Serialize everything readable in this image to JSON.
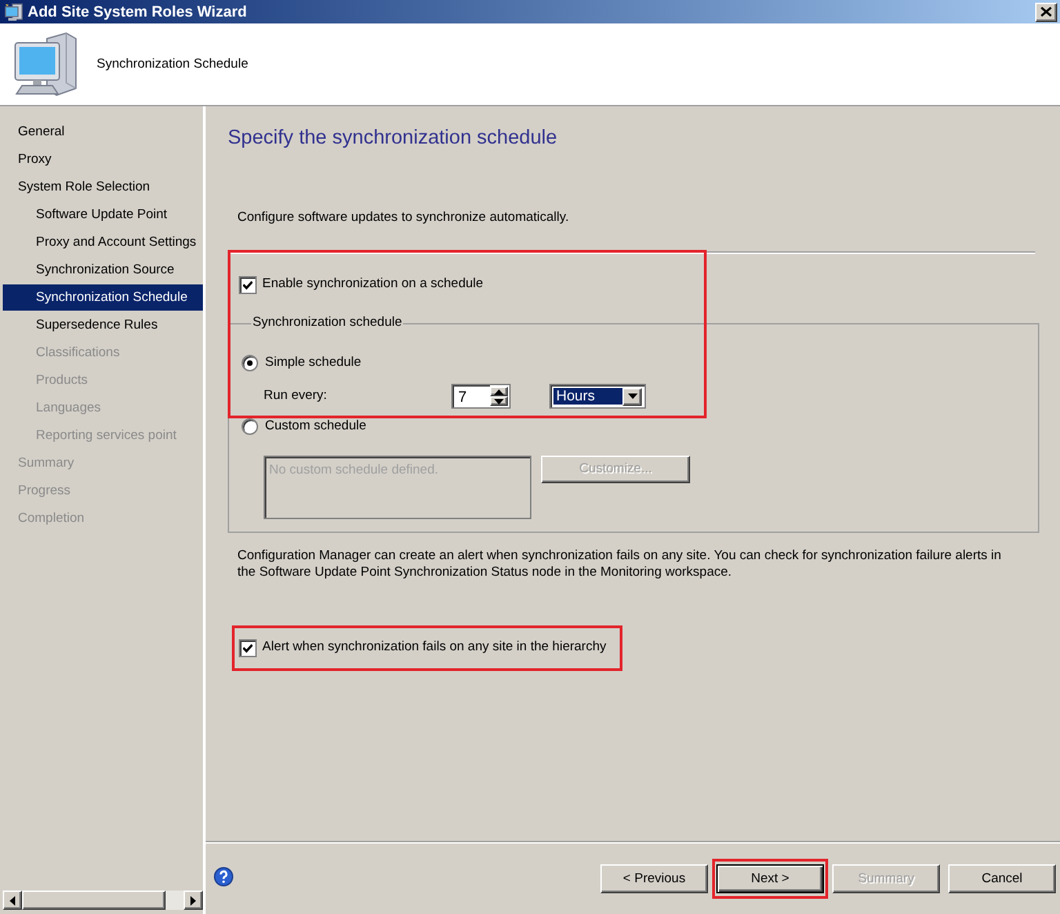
{
  "window": {
    "title": "Add Site System Roles Wizard"
  },
  "header": {
    "title": "Synchronization Schedule"
  },
  "sidebar": {
    "items": [
      {
        "label": "General",
        "selected": false,
        "disabled": false
      },
      {
        "label": "Proxy",
        "selected": false,
        "disabled": false
      },
      {
        "label": "System Role Selection",
        "selected": false,
        "disabled": false,
        "children": [
          {
            "label": "Software Update Point",
            "selected": false,
            "disabled": false
          },
          {
            "label": "Proxy and Account Settings",
            "selected": false,
            "disabled": false
          },
          {
            "label": "Synchronization Source",
            "selected": false,
            "disabled": false
          },
          {
            "label": "Synchronization Schedule",
            "selected": true,
            "disabled": false
          },
          {
            "label": "Supersedence Rules",
            "selected": false,
            "disabled": false
          },
          {
            "label": "Classifications",
            "selected": false,
            "disabled": true
          },
          {
            "label": "Products",
            "selected": false,
            "disabled": true
          },
          {
            "label": "Languages",
            "selected": false,
            "disabled": true
          },
          {
            "label": "Reporting services point",
            "selected": false,
            "disabled": true
          }
        ]
      },
      {
        "label": "Summary",
        "selected": false,
        "disabled": true
      },
      {
        "label": "Progress",
        "selected": false,
        "disabled": true
      },
      {
        "label": "Completion",
        "selected": false,
        "disabled": true
      }
    ]
  },
  "page": {
    "heading": "Specify the synchronization schedule",
    "intro": "Configure software updates to synchronize automatically.",
    "enable_checkbox": {
      "label": "Enable synchronization on a schedule",
      "checked": true,
      "highlighted": true
    },
    "schedule_group": {
      "title": "Synchronization schedule",
      "options": [
        {
          "label": "Simple schedule",
          "selected": true
        },
        {
          "label": "Custom schedule",
          "selected": false
        }
      ],
      "run_every": {
        "label": "Run every:",
        "value": "7",
        "unit": "Hours",
        "focused": true
      },
      "custom_schedule": {
        "text": "No custom schedule defined.",
        "disabled": true
      },
      "customize_button": {
        "label": "Customize...",
        "disabled": true
      }
    },
    "alert_info": "Configuration Manager can create an alert when synchronization fails on any site. You can check for synchronization failure alerts in the Software Update Point Synchronization Status node in the Monitoring workspace.",
    "alert_checkbox": {
      "label": "Alert when synchronization fails on any site in the hierarchy",
      "checked": true,
      "highlighted": true
    }
  },
  "footer": {
    "buttons": [
      {
        "label": "< Previous",
        "default": false,
        "disabled": false,
        "highlighted": false
      },
      {
        "label": "Next >",
        "default": true,
        "disabled": false,
        "highlighted": true
      },
      {
        "label": "Summary",
        "default": false,
        "disabled": true,
        "highlighted": false
      },
      {
        "label": "Cancel",
        "default": false,
        "disabled": false,
        "highlighted": false
      }
    ]
  }
}
